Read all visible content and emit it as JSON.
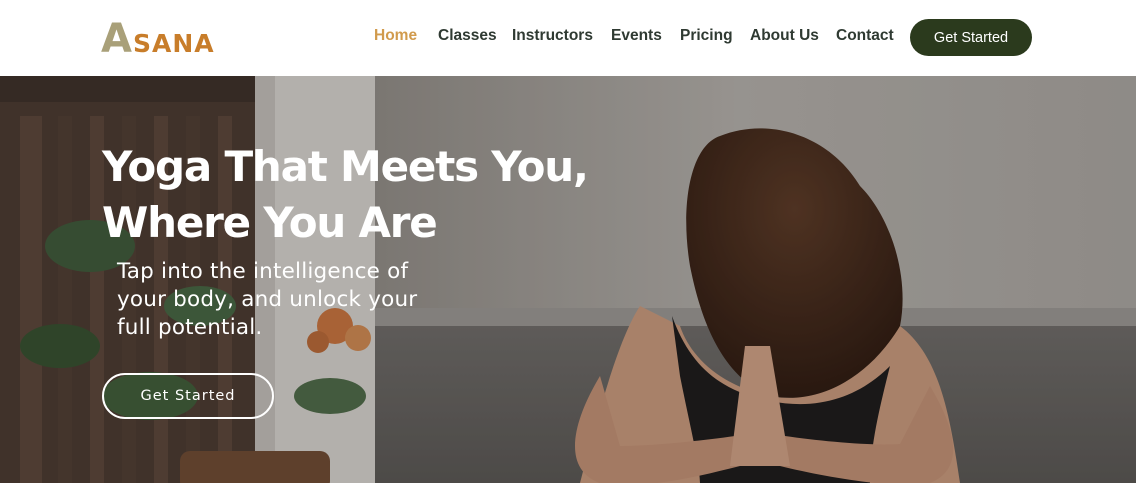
{
  "brand": {
    "logo_initial": "A",
    "logo_rest": "SANA"
  },
  "nav": {
    "items": [
      {
        "label": "Home",
        "active": true
      },
      {
        "label": "Classes"
      },
      {
        "label": "Instructors"
      },
      {
        "label": "Events"
      },
      {
        "label": "Pricing"
      },
      {
        "label": "About Us"
      },
      {
        "label": "Contact"
      }
    ],
    "cta_label": "Get Started"
  },
  "hero": {
    "title_line1": "Yoga That Meets You,",
    "title_line2": "Where You Are",
    "subtitle_line1": "Tap into the intelligence of",
    "subtitle_line2": "your body, and unlock your",
    "subtitle_line3": "full potential.",
    "button_label": "Get Started"
  },
  "colors": {
    "nav_text": "#2f3a32",
    "nav_active": "#d19b4d",
    "cta_background": "#2b3a1d",
    "logo_initial": "#a9a079",
    "logo_rest": "#c87d2a"
  }
}
